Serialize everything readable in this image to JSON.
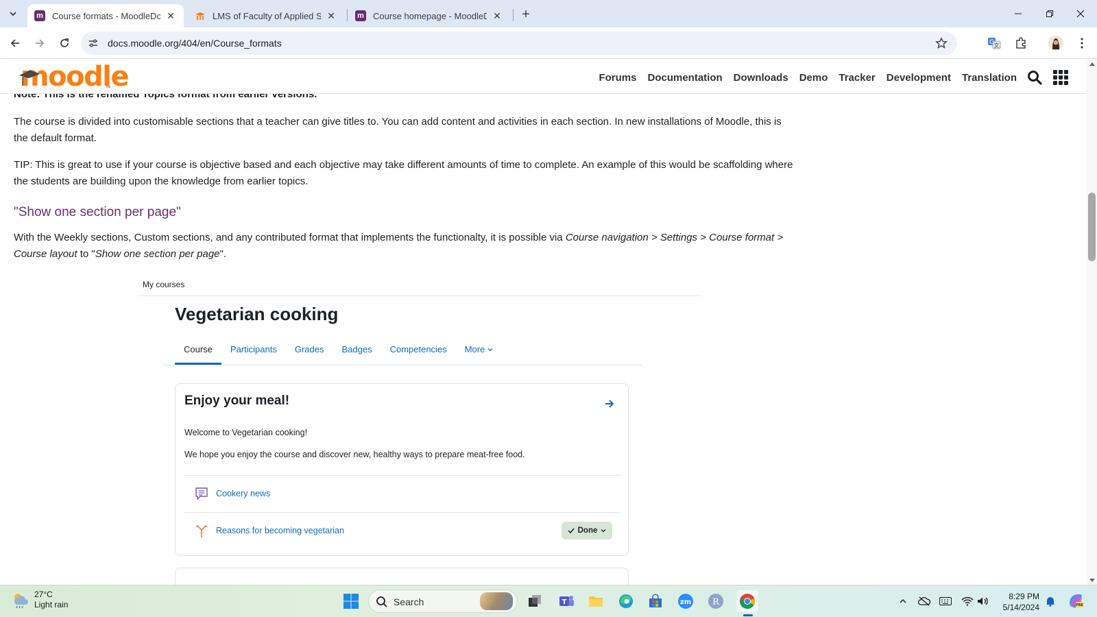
{
  "browser": {
    "tabs": [
      {
        "title": "Course formats - MoodleDocs",
        "favicon": "moodle-m",
        "active": true
      },
      {
        "title": "LMS of Faculty of Applied Scien",
        "favicon": "moodle-hat",
        "active": false
      },
      {
        "title": "Course homepage - MoodleDo",
        "favicon": "moodle-m",
        "active": false
      }
    ],
    "url": "docs.moodle.org/404/en/Course_formats"
  },
  "site": {
    "logo": "moodle",
    "nav": [
      "Forums",
      "Documentation",
      "Downloads",
      "Demo",
      "Tracker",
      "Development",
      "Translation"
    ]
  },
  "article": {
    "note": "Note: This is the renamed Topics format from earlier versions.",
    "para1": "The course is divided into customisable sections that a teacher can give titles to. You can add content and activities in each section. In new installations of Moodle, this is the default format.",
    "para2": "TIP: This is great to use if your course is objective based and each objective may take different amounts of time to complete. An example of this would be scaffolding where the students are building upon the knowledge from earlier topics.",
    "heading": "\"Show one section per page\"",
    "para3": {
      "pre": "With the Weekly sections, Custom sections, and any contributed format that implements the functionalty, it is possible via ",
      "path": "Course navigation > Settings > Course format > Course layout",
      "mid": " to \"",
      "option": "Show one section per page",
      "post": "\"."
    }
  },
  "embedded": {
    "breadcrumb": "My courses",
    "course_title": "Vegetarian cooking",
    "tabs": [
      "Course",
      "Participants",
      "Grades",
      "Badges",
      "Competencies",
      "More"
    ],
    "card": {
      "title": "Enjoy your meal!",
      "line1": "Welcome to Vegetarian cooking!",
      "line2": "We hope you enjoy the course and discover  new, healthy ways to prepare meat-free food.",
      "activities": [
        {
          "label": "Cookery news",
          "icon": "forum-icon"
        },
        {
          "label": "Reasons for becoming vegetarian",
          "icon": "choice-icon",
          "status": "Done"
        }
      ]
    }
  },
  "taskbar": {
    "weather_temp": "27°C",
    "weather_desc": "Light rain",
    "search": "Search",
    "time": "8:29 PM",
    "date": "5/14/2024"
  },
  "colors": {
    "moodle_orange": "#f98012",
    "heading_purple": "#6a2e71",
    "link_blue": "#0f6cbf",
    "done_green": "#d7e4d6"
  }
}
